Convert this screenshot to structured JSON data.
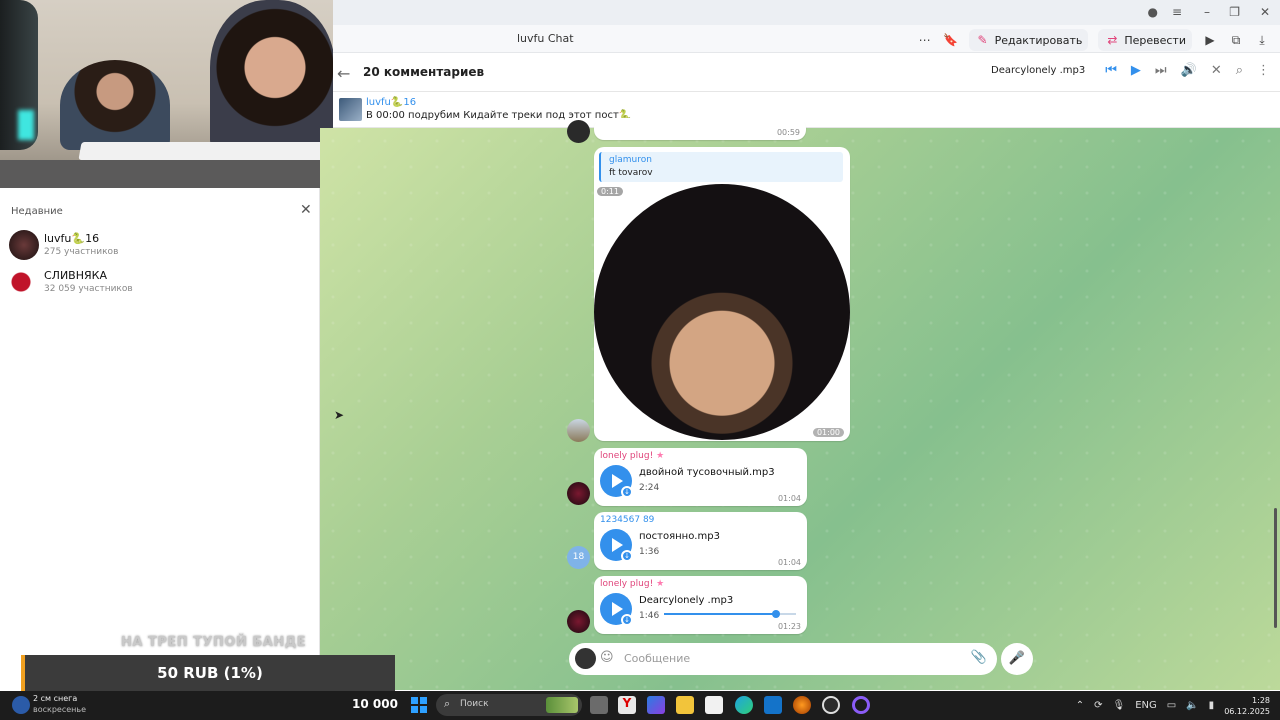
{
  "browser": {
    "tab_title": "luvfu Chat",
    "edit_label": "Редактировать",
    "translate_label": "Перевести"
  },
  "chat": {
    "header_title": "20 комментариев",
    "player_track": "Dearcylonely .mp3",
    "pinned": {
      "name": "luvfu🐍16",
      "text": "В 00:00 подрубим Кидайте треки под этот пост🐍"
    },
    "messages": [
      {
        "time": "00:59"
      },
      {
        "reply_name": "glamuron",
        "reply_text": "ft tovarov",
        "video_elapsed": "0:11",
        "time": "01:00"
      },
      {
        "sender": "lonely plug!",
        "file": "двойной тусовочный.mp3",
        "duration": "2:24",
        "time": "01:04"
      },
      {
        "sender": "1234567 89",
        "avatar_badge": "18",
        "file": "постоянно.mp3",
        "duration": "1:36",
        "time": "01:04"
      },
      {
        "sender": "lonely plug!",
        "file": "Dearcylonely .mp3",
        "duration": "1:46",
        "time": "01:23",
        "progress": 0.85
      }
    ],
    "composer_placeholder": "Сообщение"
  },
  "recent": {
    "title": "Недавние",
    "items": [
      {
        "name": "luvfu🐍16",
        "sub": "275 участников"
      },
      {
        "name": "СЛИВНЯКА",
        "sub": "32 059 участников"
      }
    ]
  },
  "stream": {
    "overlay_text": "НА ТРЕП ТУПОЙ БАНДЕ",
    "donation": "50 RUB (1%)",
    "counter": "10 000"
  },
  "taskbar": {
    "weather_line1": "2 см снега",
    "weather_line2": "воскресенье",
    "search_placeholder": "Поиск",
    "lang": "ENG",
    "time": "1:28",
    "date": "06.12.2025"
  },
  "colors": {
    "accent": "#3390ec",
    "sender_pink": "#e0457b"
  }
}
